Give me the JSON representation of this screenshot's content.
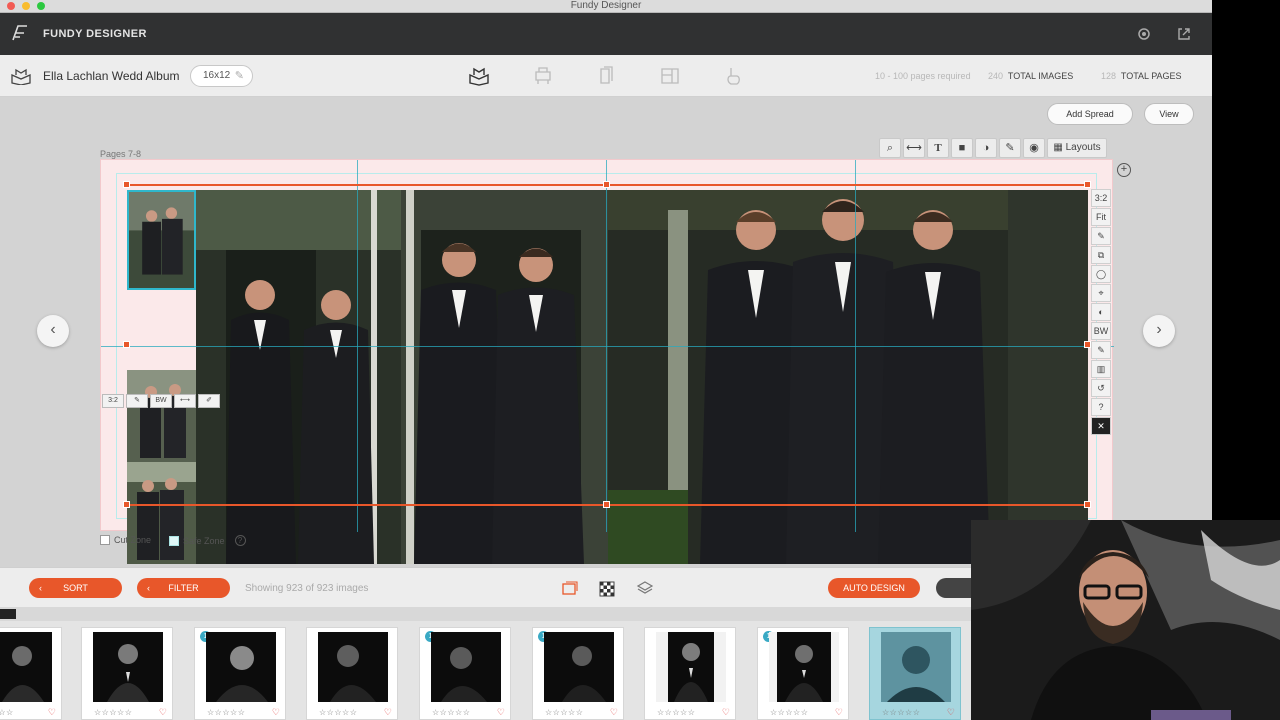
{
  "window": {
    "title": "Fundy Designer"
  },
  "header": {
    "app_name": "FUNDY DESIGNER",
    "icons": [
      "logo-icon",
      "settings-gear-icon",
      "external-link-icon"
    ]
  },
  "album": {
    "title": "Ella Lachlan Wedd Album",
    "size": "16x12",
    "pages_required": "10 - 100 pages required",
    "total_images_count": "240",
    "total_images_label": "TOTAL IMAGES",
    "total_pages_count": "128",
    "total_pages_label": "TOTAL PAGES",
    "modes": [
      "album-mode-icon",
      "wall-art-icon",
      "cards-icon",
      "blog-collage-icon",
      "proofing-icon"
    ]
  },
  "workspace": {
    "add_spread": "Add Spread",
    "view": "View",
    "pages_label": "Pages 7-8",
    "aspect_label": "3:2",
    "layouts_label": "Layouts",
    "bw_label": "BW",
    "fit_label": "Fit",
    "cut_zone": "Cut Zone",
    "safe_zone": "Safe Zone",
    "toolbar_icons": [
      "zoom-icon",
      "line-icon",
      "text-icon",
      "shape-icon",
      "color-icon",
      "eyedropper-icon",
      "eye-icon"
    ],
    "side_tools": [
      "3:2",
      "Fit",
      "✎",
      "⧉",
      "◯",
      "⌖",
      "◐",
      "BW",
      "✎",
      "▥",
      "↺",
      "?",
      "✕"
    ]
  },
  "filter_bar": {
    "sort": "SORT",
    "filter": "FILTER",
    "showing": "Showing 923 of 923 images",
    "auto_design": "AUTO DESIGN"
  },
  "film_strip": {
    "thumbnails": [
      {
        "stars": "☆☆☆☆",
        "badge": "",
        "selected": false
      },
      {
        "stars": "☆☆☆☆☆",
        "badge": "",
        "selected": false
      },
      {
        "stars": "☆☆☆☆☆",
        "badge": "1",
        "selected": false
      },
      {
        "stars": "☆☆☆☆☆",
        "badge": "",
        "selected": false
      },
      {
        "stars": "☆☆☆☆☆",
        "badge": "1",
        "selected": false
      },
      {
        "stars": "☆☆☆☆☆",
        "badge": "1",
        "selected": false
      },
      {
        "stars": "☆☆☆☆☆",
        "badge": "",
        "selected": false
      },
      {
        "stars": "☆☆☆☆☆",
        "badge": "1",
        "selected": false
      },
      {
        "stars": "☆☆☆☆☆",
        "badge": "",
        "selected": true
      }
    ]
  },
  "colors": {
    "accent": "#e8572a",
    "guide": "#28aabe",
    "header": "#303132"
  }
}
